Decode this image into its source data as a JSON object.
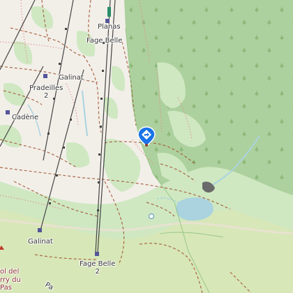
{
  "map": {
    "labels": {
      "planas": "Planas",
      "fage_belle_top": "Fage Belle",
      "galinat_top": "Galinat",
      "pradeilles": "Pradeilles\n2",
      "cadene": "Cadène",
      "galinat_bottom": "Galinat",
      "fage_belle_bottom": "Fage Belle\n2",
      "col_del": "ol del",
      "rry_du": "rry du",
      "pas": "Pas",
      "pa": "Pa"
    },
    "icons": {
      "marker": "location-direction-marker-icon",
      "station": "lift-station-icon",
      "viewpoint": "viewpoint-icon"
    },
    "colors": {
      "land": "#f2efe9",
      "meadow": "#cfe8c2",
      "forest": "#add19e",
      "grass": "#d7e7b8",
      "water": "#aad3df",
      "marker": "#1a73e8",
      "path": "#a0522d",
      "lift": "#444444"
    }
  }
}
